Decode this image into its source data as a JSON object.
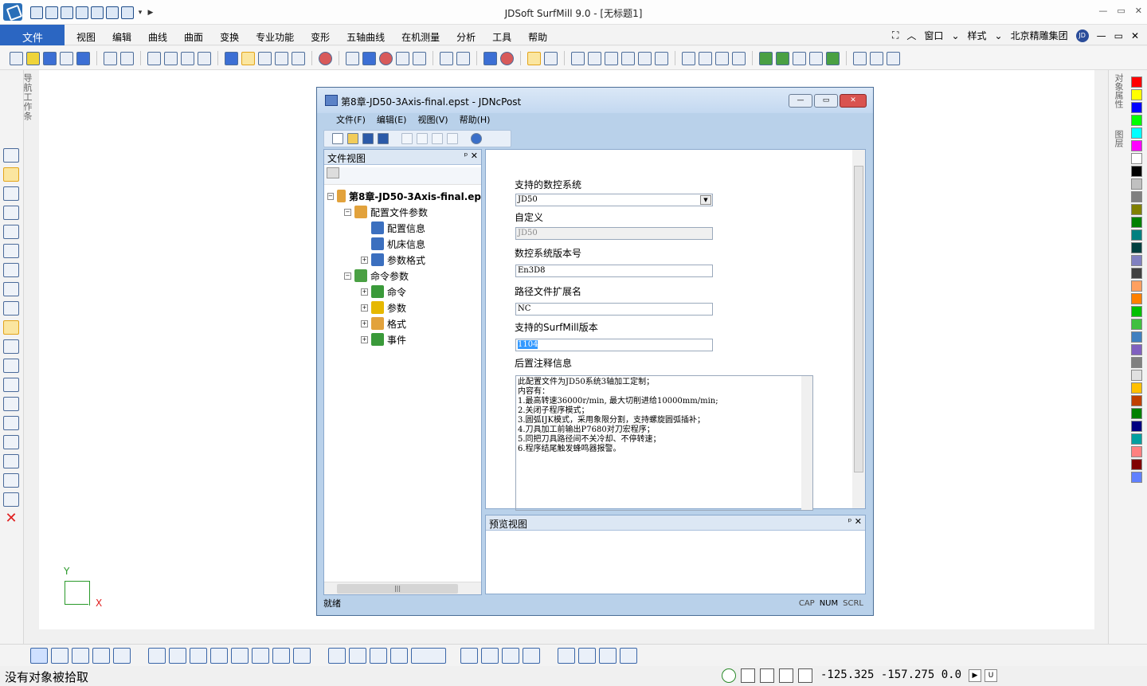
{
  "app": {
    "title": "JDSoft SurfMill 9.0 - [无标题1]",
    "file_tab": "文件",
    "menus": [
      "视图",
      "编辑",
      "曲线",
      "曲面",
      "变换",
      "专业功能",
      "变形",
      "五轴曲线",
      "在机测量",
      "分析",
      "工具",
      "帮助"
    ],
    "right_menu": {
      "window": "窗口",
      "style": "样式",
      "company": "北京精雕集团",
      "logo": "JD"
    }
  },
  "left_panel": {
    "vertical_label": "导航工作条"
  },
  "right_panel": {
    "labels": [
      "对象属性",
      "图层"
    ],
    "palette": [
      "#ff0000",
      "#ffff00",
      "#0000ff",
      "#00ff00",
      "#00ffff",
      "#ff00ff",
      "#ffffff",
      "#000000",
      "#c0c0c0",
      "#808080",
      "#808000",
      "#008000",
      "#008080",
      "#004040",
      "#8080c0",
      "#404040",
      "#ffa060",
      "#ff8000",
      "#00c000",
      "#40c040",
      "#4080c0",
      "#8060c0",
      "#808080",
      "#e0e0e0",
      "#ffc000",
      "#c04000",
      "#008000",
      "#000080",
      "#00a0a0",
      "#ff8080",
      "#800000",
      "#6080ff"
    ]
  },
  "axis": {
    "y": "Y",
    "x": "X"
  },
  "status": {
    "message": "没有对象被拾取",
    "coords": "-125.325  -157.275  0.0"
  },
  "dialog": {
    "title": "第8章-JD50-3Axis-final.epst - JDNcPost",
    "menu": [
      "文件(F)",
      "编辑(E)",
      "视图(V)",
      "帮助(H)"
    ],
    "file_view": {
      "title": "文件视图",
      "pins": "ᵖ ✕",
      "tree": [
        {
          "label": "第8章-JD50-3Axis-final.ep",
          "level": 0,
          "toggle": "−",
          "bold": true,
          "color": "#e2a23c"
        },
        {
          "label": "配置文件参数",
          "level": 1,
          "toggle": "−",
          "bold": false,
          "color": "#e2a23c"
        },
        {
          "label": "配置信息",
          "level": 2,
          "toggle": "",
          "bold": false,
          "color": "#3b6fbf"
        },
        {
          "label": "机床信息",
          "level": 2,
          "toggle": "",
          "bold": false,
          "color": "#3b6fbf"
        },
        {
          "label": "参数格式",
          "level": 2,
          "toggle": "+",
          "bold": false,
          "color": "#3b6fbf"
        },
        {
          "label": "命令参数",
          "level": 1,
          "toggle": "−",
          "bold": false,
          "color": "#4aa043"
        },
        {
          "label": "命令",
          "level": 2,
          "toggle": "+",
          "bold": false,
          "color": "#3a9a3a"
        },
        {
          "label": "参数",
          "level": 2,
          "toggle": "+",
          "bold": false,
          "color": "#e6b800"
        },
        {
          "label": "格式",
          "level": 2,
          "toggle": "+",
          "bold": false,
          "color": "#e2a23c"
        },
        {
          "label": "事件",
          "level": 2,
          "toggle": "+",
          "bold": false,
          "color": "#3a9a3a"
        }
      ]
    },
    "form": {
      "cnc_label": "支持的数控系统",
      "cnc_value": "JD50",
      "custom_label": "自定义",
      "custom_value": "JD50",
      "version_label": "数控系统版本号",
      "version_value": "En3D8",
      "ext_label": "路径文件扩展名",
      "ext_value": "NC",
      "surfmill_label": "支持的SurfMill版本",
      "surfmill_value": "1104",
      "notes_label": "后置注释信息",
      "notes": [
        "此配置文件为JD50系统3轴加工定制；",
        "内容有：",
        "1.最高转速36000r/min, 最大切削进给10000mm/min;",
        "2.关闭子程序模式；",
        "3.圆弧IJK模式，采用象限分割，支持螺旋圆弧插补；",
        "4.刀具加工前输出P7680对刀宏程序；",
        "5.同把刀具路径间不关冷却、不停转速；",
        "6.程序结尾触发蜂鸣器报警。"
      ]
    },
    "preview": {
      "title": "预览视图",
      "pins": "ᵖ ✕"
    },
    "status": {
      "text": "就绪",
      "keys": [
        "CAP",
        "NUM",
        "SCRL"
      ]
    }
  }
}
